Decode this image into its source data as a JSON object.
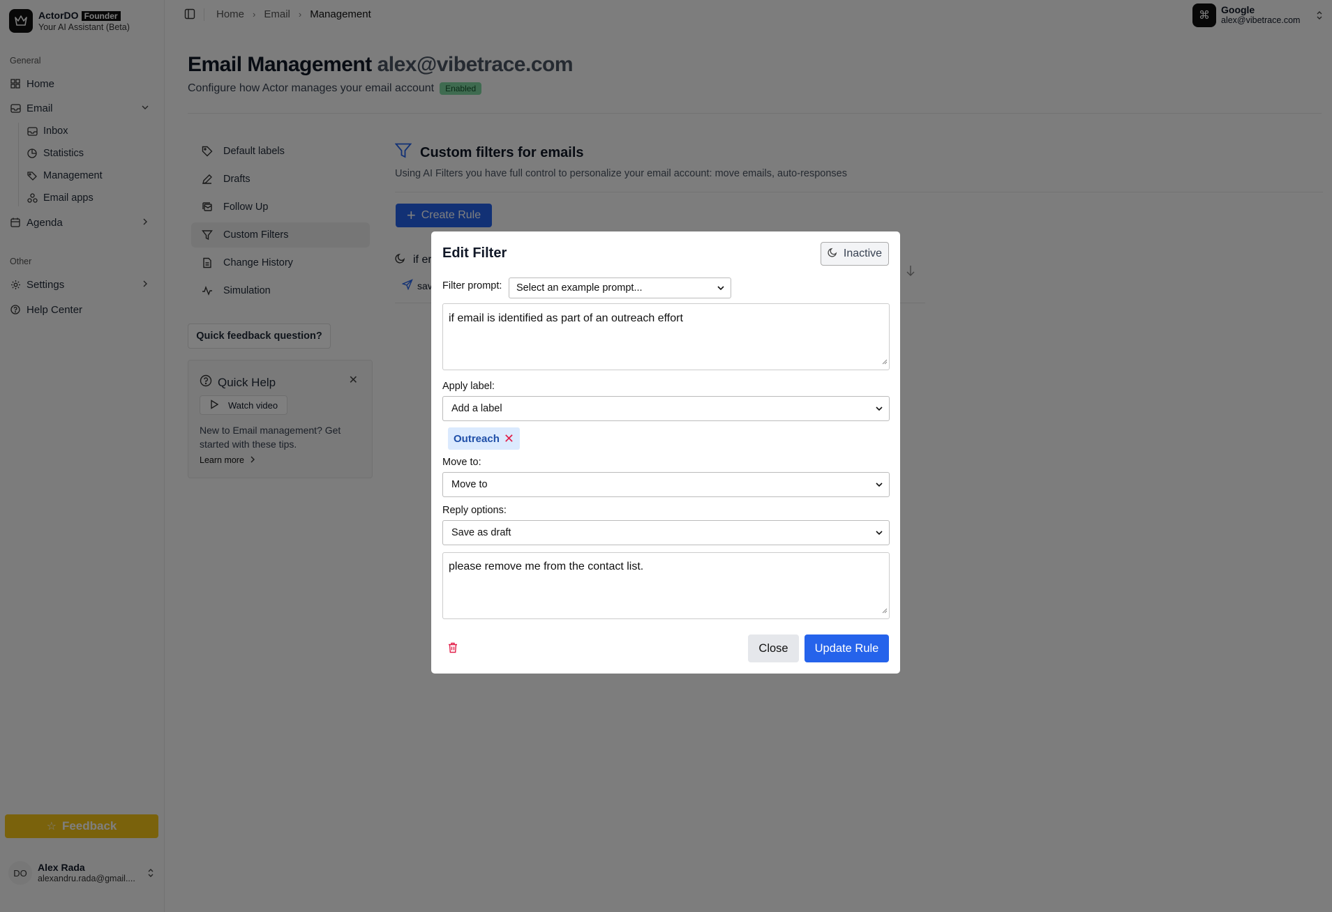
{
  "brand": {
    "name": "ActorDO",
    "badge": "Founder",
    "subtitle": "Your AI Assistant (Beta)"
  },
  "sidebar": {
    "general_label": "General",
    "other_label": "Other",
    "home": "Home",
    "email": "Email",
    "email_sub": [
      "Inbox",
      "Statistics",
      "Management",
      "Email apps"
    ],
    "agenda": "Agenda",
    "settings": "Settings",
    "help": "Help Center",
    "feedback": "Feedback",
    "user": {
      "initials": "DO",
      "name": "Alex Rada",
      "email": "alexandru.rada@gmail...."
    }
  },
  "topbar": {
    "breadcrumbs": [
      "Home",
      "Email",
      "Management"
    ],
    "account": {
      "name": "Google",
      "email": "alex@vibetrace.com"
    }
  },
  "page": {
    "title": "Email Management",
    "title_address": "alex@vibetrace.com",
    "subtitle": "Configure how Actor manages your email account",
    "status_badge": "Enabled"
  },
  "subnav": [
    "Default labels",
    "Drafts",
    "Follow Up",
    "Custom Filters",
    "Change History",
    "Simulation"
  ],
  "quick_feedback": "Quick feedback question?",
  "quick_help": {
    "title": "Quick Help",
    "watch_video": "Watch video",
    "text": "New to Email management? Get started with these tips.",
    "learn_more": "Learn more"
  },
  "filters": {
    "title": "Custom filters for emails",
    "description": "Using AI Filters you have full control to personalize your email account: move emails, auto-responses",
    "create_rule": "Create Rule",
    "rule_preview": "if er",
    "rule_action_preview": "sav"
  },
  "modal": {
    "title": "Edit Filter",
    "status_button": "Inactive",
    "filter_prompt_label": "Filter prompt:",
    "filter_prompt_select": "Select an example prompt...",
    "prompt_text": "if email is identified as part of an outreach effort",
    "apply_label_label": "Apply label:",
    "apply_label_select": "Add a label",
    "chip": "Outreach",
    "move_to_label": "Move to:",
    "move_to_select": "Move to",
    "reply_options_label": "Reply options:",
    "reply_options_select": "Save as draft",
    "reply_text": "please remove me from the contact list.",
    "close": "Close",
    "update": "Update Rule"
  }
}
